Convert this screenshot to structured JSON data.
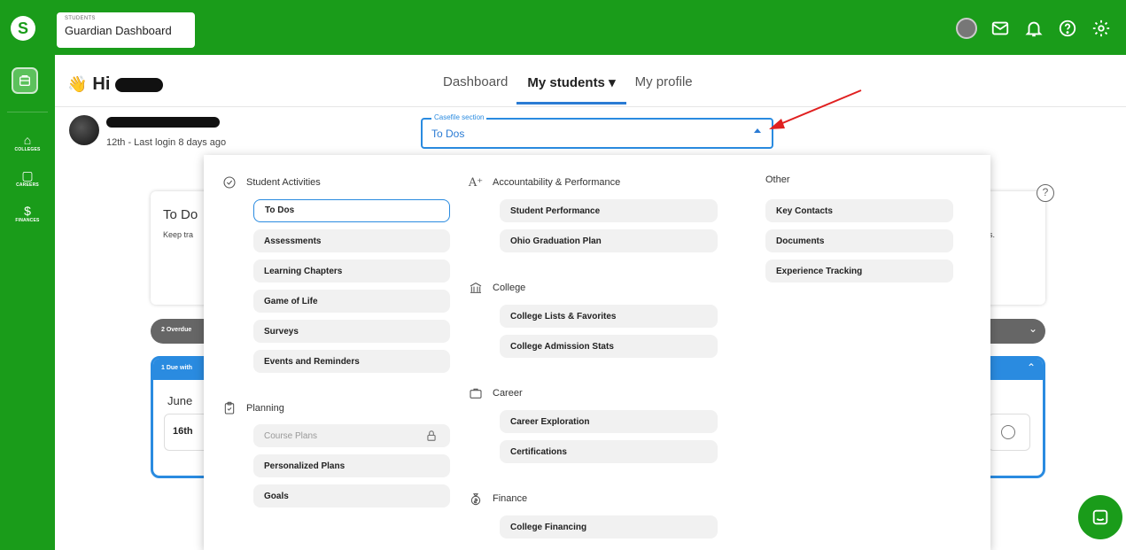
{
  "app": {
    "kicker": "STUDENTS",
    "title": "Guardian Dashboard"
  },
  "sidebar": {
    "items": [
      {
        "label": "COLLEGES",
        "icon": "college-icon"
      },
      {
        "label": "CAREERS",
        "icon": "briefcase-icon"
      },
      {
        "label": "FINANCES",
        "icon": "money-bag-icon"
      }
    ]
  },
  "greeting": {
    "wave": "👋",
    "text": "Hi"
  },
  "nav": {
    "tabs": [
      {
        "label": "Dashboard"
      },
      {
        "label": "My students ▾",
        "active": true
      },
      {
        "label": "My profile"
      }
    ]
  },
  "student": {
    "meta": "12th - Last login 8 days ago"
  },
  "casefile": {
    "label": "Casefile section",
    "value": "To Dos"
  },
  "background": {
    "card_title": "To Do",
    "card_sub": "Keep tra",
    "card_sub_right": "s.",
    "help": "?",
    "overdue": "2 Overdue",
    "due": "1 Due with",
    "month": "June",
    "day": "16th"
  },
  "menu": {
    "student_activities": {
      "title": "Student Activities",
      "items": [
        "To Dos",
        "Assessments",
        "Learning Chapters",
        "Game of Life",
        "Surveys",
        "Events and Reminders"
      ]
    },
    "planning": {
      "title": "Planning",
      "items": [
        "Course Plans",
        "Personalized Plans",
        "Goals"
      ]
    },
    "accountability": {
      "title": "Accountability & Performance",
      "items": [
        "Student Performance",
        "Ohio Graduation Plan"
      ]
    },
    "college": {
      "title": "College",
      "items": [
        "College Lists & Favorites",
        "College Admission Stats"
      ]
    },
    "career": {
      "title": "Career",
      "items": [
        "Career Exploration",
        "Certifications"
      ]
    },
    "finance": {
      "title": "Finance",
      "items": [
        "College Financing"
      ]
    },
    "other": {
      "title": "Other",
      "items": [
        "Key Contacts",
        "Documents",
        "Experience Tracking"
      ]
    }
  },
  "colors": {
    "brand_green": "#1a9c1a",
    "accent_blue": "#2a8be0",
    "annotation_red": "#e02020"
  }
}
